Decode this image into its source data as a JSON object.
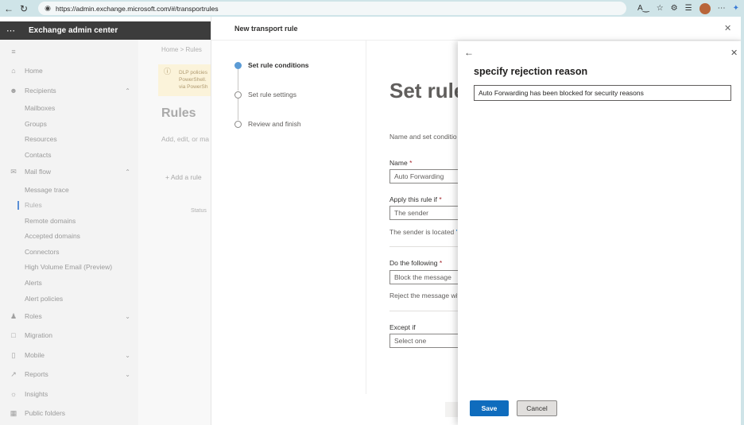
{
  "browser": {
    "url": "https://admin.exchange.microsoft.com/#/transportrules",
    "back_icon": "back-arrow-icon",
    "refresh_icon": "refresh-icon"
  },
  "app": {
    "title": "Exchange admin center"
  },
  "sidebar": {
    "items": [
      {
        "label": "Home",
        "icon": "home-icon"
      },
      {
        "label": "Recipients",
        "icon": "person-icon"
      },
      {
        "label": "Mailboxes"
      },
      {
        "label": "Groups"
      },
      {
        "label": "Resources"
      },
      {
        "label": "Contacts"
      },
      {
        "label": "Mail flow",
        "icon": "mail-icon"
      },
      {
        "label": "Message trace"
      },
      {
        "label": "Rules"
      },
      {
        "label": "Remote domains"
      },
      {
        "label": "Accepted domains"
      },
      {
        "label": "Connectors"
      },
      {
        "label": "High Volume Email (Preview)"
      },
      {
        "label": "Alerts"
      },
      {
        "label": "Alert policies"
      },
      {
        "label": "Roles",
        "icon": "roles-icon"
      },
      {
        "label": "Migration",
        "icon": "migration-icon"
      },
      {
        "label": "Mobile",
        "icon": "mobile-icon"
      },
      {
        "label": "Reports",
        "icon": "reports-icon"
      },
      {
        "label": "Insights",
        "icon": "insights-icon"
      },
      {
        "label": "Public folders",
        "icon": "folder-icon"
      }
    ]
  },
  "rules_page": {
    "breadcrumb": "Home  >  Rules",
    "info_lines": [
      "DLP policies",
      "PowerShell.",
      "via PowerSh"
    ],
    "title": "Rules",
    "subtitle": "Add, edit, or ma",
    "add_rule": "Add a rule",
    "status_col": "Status"
  },
  "transport_panel": {
    "title": "New transport rule",
    "steps": [
      {
        "label": "Set rule conditions",
        "active": true
      },
      {
        "label": "Set rule settings",
        "active": false
      },
      {
        "label": "Review and finish",
        "active": false
      }
    ],
    "heading": "Set rule",
    "description": "Name and set conditio",
    "name_label": "Name",
    "name_value": "Auto Forwarding",
    "apply_label": "Apply this rule if",
    "apply_value": "The sender",
    "apply_note": "The sender is located",
    "apply_note_link": "'",
    "do_label": "Do the following",
    "do_value": "Block the message",
    "do_note": "Reject the message wit",
    "except_label": "Except if",
    "except_value": "Select one",
    "required_mark": "*"
  },
  "reject_pane": {
    "title": "specify rejection reason",
    "input_value": "Auto Forwarding has been blocked for security reasons",
    "save_label": "Save",
    "cancel_label": "Cancel"
  }
}
